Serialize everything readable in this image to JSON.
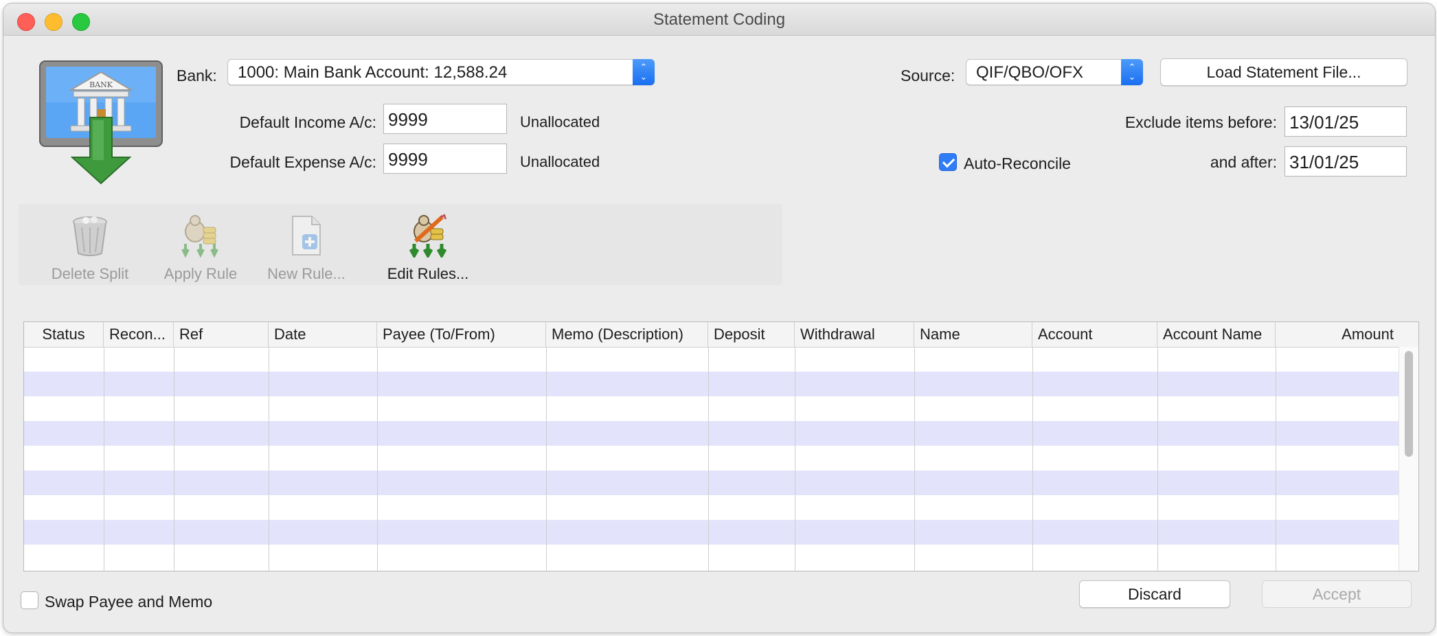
{
  "window": {
    "title": "Statement Coding"
  },
  "bank": {
    "label": "Bank:",
    "selected": "1000: Main Bank Account: 12,588.24",
    "icon": "bank-import-icon"
  },
  "defaults": {
    "income_label": "Default Income A/c:",
    "income_value": "9999",
    "income_name": "Unallocated",
    "expense_label": "Default Expense A/c:",
    "expense_value": "9999",
    "expense_name": "Unallocated"
  },
  "source": {
    "label": "Source:",
    "selected": "QIF/QBO/OFX",
    "load_button": "Load Statement File..."
  },
  "filters": {
    "exclude_before_label": "Exclude items before:",
    "exclude_before_value": "13/01/25",
    "and_after_label": "and after:",
    "and_after_value": "31/01/25",
    "auto_reconcile_label": "Auto-Reconcile",
    "auto_reconcile_checked": true
  },
  "toolbar": {
    "delete_split": "Delete Split",
    "apply_rule": "Apply Rule",
    "new_rule": "New Rule...",
    "edit_rules": "Edit Rules..."
  },
  "table": {
    "columns": [
      "Status",
      "Recon...",
      "Ref",
      "Date",
      "Payee (To/From)",
      "Memo (Description)",
      "Deposit",
      "Withdrawal",
      "Name",
      "Account",
      "Account Name",
      "Amount"
    ],
    "rows": []
  },
  "footer": {
    "swap_label": "Swap Payee and Memo",
    "swap_checked": false,
    "discard": "Discard",
    "accept": "Accept"
  },
  "colors": {
    "accent": "#2f7cf6",
    "row_alt": "#e3e4fb"
  }
}
